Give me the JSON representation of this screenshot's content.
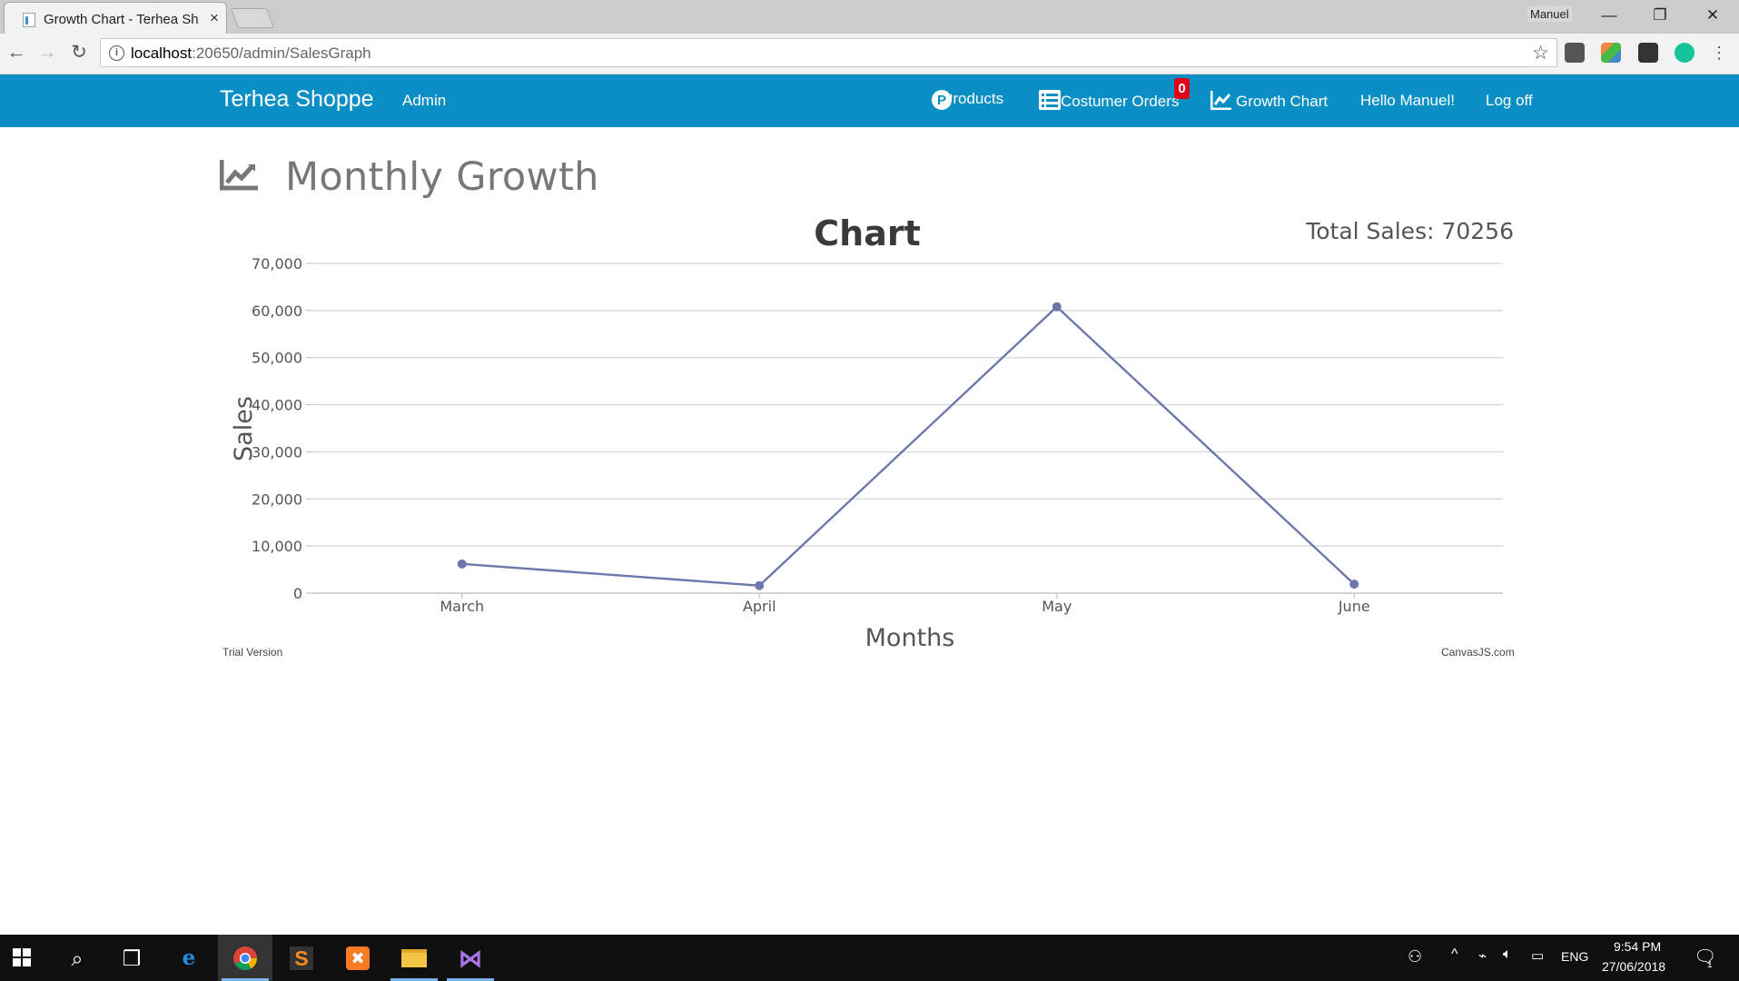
{
  "browser": {
    "tab_title": "Growth Chart - Terhea Sh",
    "tab_close": "×",
    "window_user": "Manuel",
    "url_host": "localhost",
    "url_rest": ":20650/admin/SalesGraph"
  },
  "navbar": {
    "brand": "Terhea Shoppe",
    "admin": "Admin",
    "products": "Products",
    "costumer_orders": "Costumer Orders",
    "orders_badge": "0",
    "growth_chart": "Growth Chart",
    "greeting": "Hello Manuel!",
    "logoff": "Log off",
    "color": "#0a8fc4"
  },
  "page": {
    "title": "Monthly Growth",
    "total_sales": "Total Sales: 70256"
  },
  "chart_data": {
    "type": "line",
    "title": "Chart",
    "xlabel": "Months",
    "ylabel": "Sales",
    "categories": [
      "March",
      "April",
      "May",
      "June"
    ],
    "series": [
      {
        "values": [
          6200,
          1600,
          60800,
          1900
        ],
        "color": "#6d78ad"
      }
    ],
    "ylim": [
      0,
      70000
    ],
    "yticks": [
      "0",
      "10,000",
      "20,000",
      "30,000",
      "40,000",
      "50,000",
      "60,000",
      "70,000"
    ],
    "grid": true,
    "credit_left": "Trial Version",
    "credit_right": "CanvasJS.com"
  },
  "taskbar": {
    "time": "9:54 PM",
    "date": "27/06/2018",
    "lang": "ENG",
    "notifications": "1"
  }
}
